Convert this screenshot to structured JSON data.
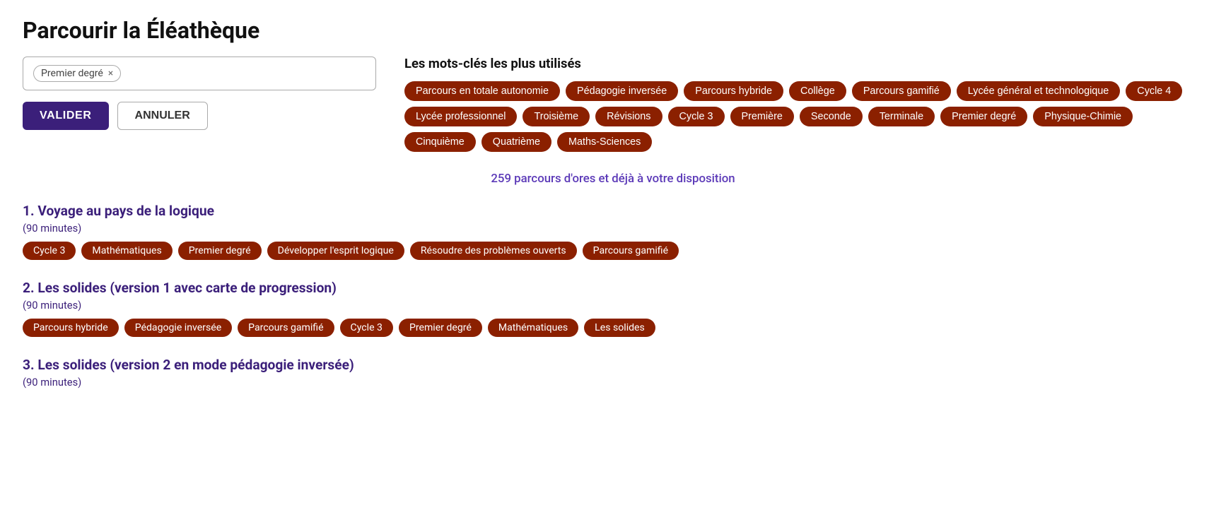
{
  "page": {
    "title": "Parcourir la Éléathèque"
  },
  "search": {
    "active_tag": "Premier degré",
    "remove_label": "×",
    "valider_label": "VALIDER",
    "annuler_label": "ANNULER"
  },
  "keywords": {
    "title": "Les mots-clés les plus utilisés",
    "tags": [
      "Parcours en totale autonomie",
      "Pédagogie inversée",
      "Parcours hybride",
      "Collège",
      "Parcours gamifié",
      "Lycée général et technologique",
      "Cycle 4",
      "Lycée professionnel",
      "Troisième",
      "Révisions",
      "Cycle 3",
      "Première",
      "Seconde",
      "Terminale",
      "Premier degré",
      "Physique-Chimie",
      "Cinquième",
      "Quatrième",
      "Maths-Sciences"
    ]
  },
  "results": {
    "count_text": "259 parcours d'ores et déjà à votre disposition",
    "items": [
      {
        "number": "1",
        "title": "Voyage au pays de la logique",
        "duration": "(90 minutes)",
        "tags": [
          "Cycle 3",
          "Mathématiques",
          "Premier degré",
          "Développer l'esprit logique",
          "Résoudre des problèmes ouverts",
          "Parcours gamifié"
        ]
      },
      {
        "number": "2",
        "title": "Les solides (version 1 avec carte de progression)",
        "duration": "(90 minutes)",
        "tags": [
          "Parcours hybride",
          "Pédagogie inversée",
          "Parcours gamifié",
          "Cycle 3",
          "Premier degré",
          "Mathématiques",
          "Les solides"
        ]
      },
      {
        "number": "3",
        "title": "Les solides (version 2 en mode pédagogie inversée)",
        "duration": "(90 minutes)",
        "tags": []
      }
    ]
  }
}
